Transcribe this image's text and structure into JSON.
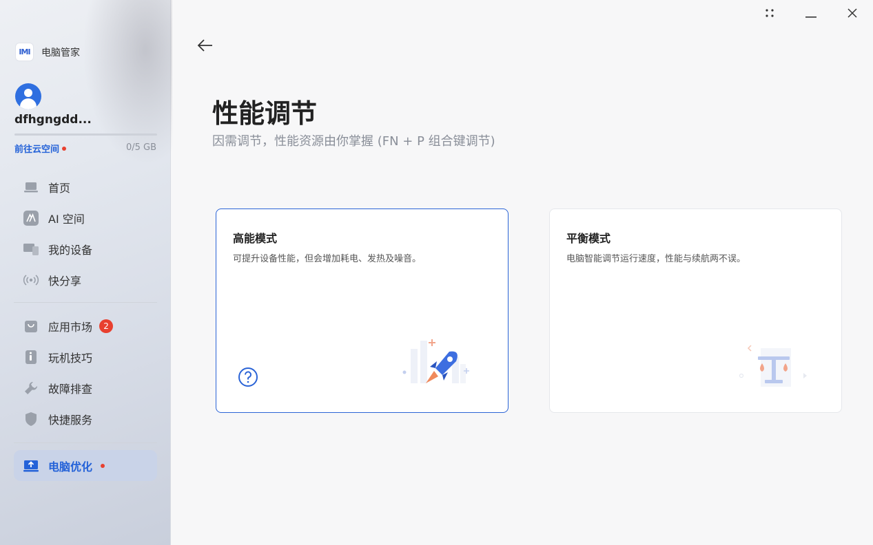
{
  "app": {
    "name": "电脑管家",
    "logo_text": "IMI"
  },
  "account": {
    "username": "dfhgngdd...",
    "cloud_link": "前往云空间",
    "storage": "0/5 GB"
  },
  "nav": {
    "group1": [
      {
        "label": "首页",
        "icon": "laptop-icon"
      },
      {
        "label": "AI 空间",
        "icon": "ai-space-icon"
      },
      {
        "label": "我的设备",
        "icon": "devices-icon"
      },
      {
        "label": "快分享",
        "icon": "share-wave-icon"
      }
    ],
    "group2": [
      {
        "label": "应用市场",
        "icon": "shopping-bag-icon",
        "badge": "2"
      },
      {
        "label": "玩机技巧",
        "icon": "tips-icon"
      },
      {
        "label": "故障排查",
        "icon": "wrench-icon"
      },
      {
        "label": "快捷服务",
        "icon": "shield-icon"
      }
    ],
    "active": {
      "label": "电脑优化",
      "icon": "pc-optimize-icon"
    }
  },
  "page": {
    "title": "性能调节",
    "subtitle": "因需调节，性能资源由你掌握 (FN + P 组合键调节)"
  },
  "modes": [
    {
      "title": "高能模式",
      "description": "可提升设备性能，但会增加耗电、发热及噪音。",
      "selected": true,
      "illustration": "rocket-icon"
    },
    {
      "title": "平衡模式",
      "description": "电脑智能调节运行速度，性能与续航两不误。",
      "selected": false,
      "illustration": "balance-scale-icon"
    }
  ],
  "colors": {
    "accent": "#2a63d6",
    "badge": "#e8402f",
    "active_nav_bg": "#c9d3e8"
  }
}
